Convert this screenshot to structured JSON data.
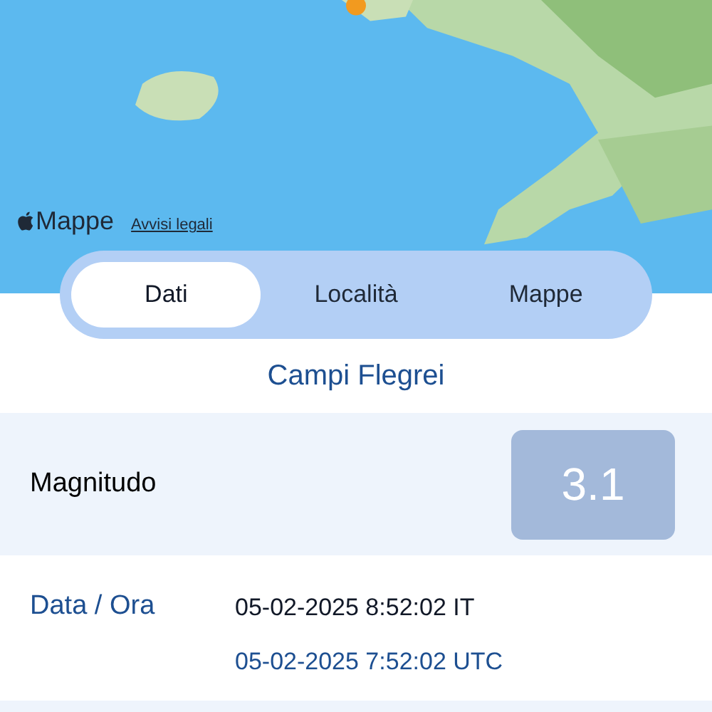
{
  "map": {
    "brand": "Mappe",
    "legal_link": "Avvisi legali"
  },
  "tabs": [
    {
      "label": "Dati",
      "selected": true
    },
    {
      "label": "Località",
      "selected": false
    },
    {
      "label": "Mappe",
      "selected": false
    }
  ],
  "title": "Campi Flegrei",
  "magnitude": {
    "label": "Magnitudo",
    "value": "3.1"
  },
  "datetime": {
    "label": "Data / Ora",
    "local": "05-02-2025 8:52:02 IT",
    "utc": "05-02-2025 7:52:02 UTC"
  }
}
